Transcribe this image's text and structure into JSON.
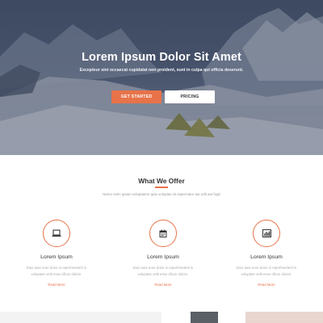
{
  "hero": {
    "title": "Lorem Ipsum Dolor Sit Amet",
    "subtitle": "Excepteur sint occaecat cupidatat non proident, sunt in culpa qui officia deserunt.",
    "primary_button": "GET STARTED",
    "secondary_button": "PRICING"
  },
  "offer": {
    "title": "What We Offer",
    "subtitle": "Nemo enim ipsam voluptatem quia voluptas sit aspernatur aut odit aut fugit",
    "features": [
      {
        "icon": "laptop-icon",
        "title": "Lorem Ipsum",
        "text_line1": "Duis aute irure dolor in reprehenderit in",
        "text_line2": "voluptate velit esse cillum dolore.",
        "link": "Read More"
      },
      {
        "icon": "calendar-icon",
        "title": "Lorem Ipsum",
        "text_line1": "Duis aute irure dolor in reprehenderit in",
        "text_line2": "voluptate velit esse cillum dolore.",
        "link": "Read More"
      },
      {
        "icon": "bar-chart-icon",
        "title": "Lorem Ipsum",
        "text_line1": "Duis aute irure dolor in reprehenderit in",
        "text_line2": "voluptate velit esse cillum dolore.",
        "link": "Read More"
      }
    ]
  },
  "colors": {
    "accent": "#e8734a",
    "hero_overlay": "#4a5770"
  }
}
